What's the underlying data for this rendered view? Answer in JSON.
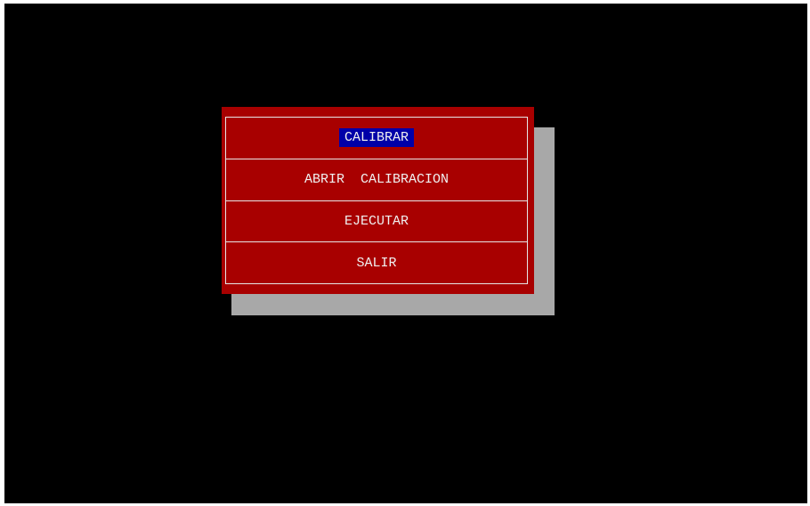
{
  "colors": {
    "background": "#000000",
    "menu_background": "#a80000",
    "menu_border": "#e6e6e6",
    "shadow": "#a8a8a8",
    "selection_background": "#0000a8",
    "text": "#f0f0f0"
  },
  "menu": {
    "items": [
      {
        "label": "CALIBRAR",
        "selected": true
      },
      {
        "label": "ABRIR  CALIBRACION",
        "selected": false
      },
      {
        "label": "EJECUTAR",
        "selected": false
      },
      {
        "label": "SALIR",
        "selected": false
      }
    ]
  }
}
